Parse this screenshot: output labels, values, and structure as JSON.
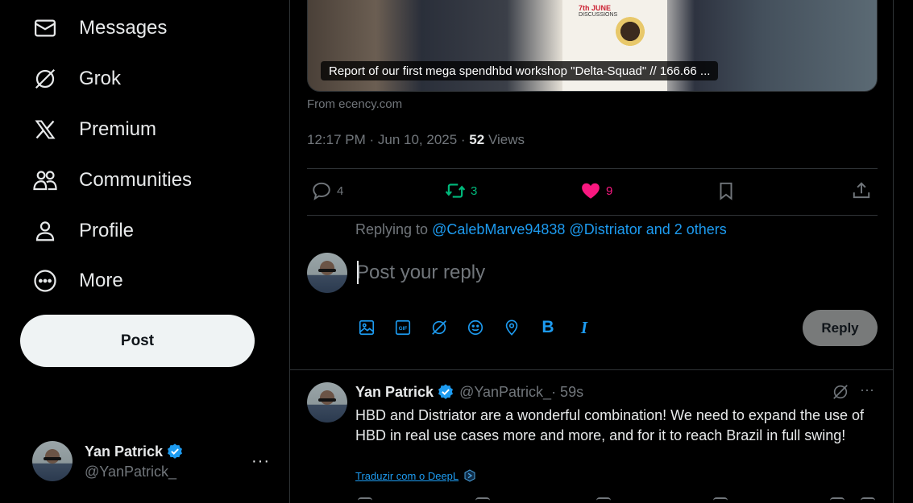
{
  "sidebar": {
    "items": [
      {
        "label": "Messages",
        "icon": "envelope-icon"
      },
      {
        "label": "Grok",
        "icon": "grok-icon"
      },
      {
        "label": "Premium",
        "icon": "x-logo-icon"
      },
      {
        "label": "Communities",
        "icon": "people-icon"
      },
      {
        "label": "Profile",
        "icon": "person-icon"
      },
      {
        "label": "More",
        "icon": "more-circle-icon"
      }
    ],
    "post_label": "Post",
    "account": {
      "name": "Yan Patrick",
      "handle": "@YanPatrick_",
      "more": "···"
    }
  },
  "post": {
    "media_caption": "Report of our first mega spendhbd workshop \"Delta-Squad\" // 166.66 ...",
    "poster_title": "7th JUNE",
    "poster_subtitle": "DISCUSSIONS",
    "source": "From ecency.com",
    "time": "12:17 PM · Jun 10, 2025 · ",
    "views_count": "52",
    "views_label": " Views",
    "stats": {
      "replies": "4",
      "reposts": "3",
      "likes": "9"
    }
  },
  "reply_box": {
    "replying_prefix": "Replying to ",
    "replying_to": "@CalebMarve94838 @Distriator and 2 others",
    "placeholder": "Post your reply",
    "reply_label": "Reply",
    "bold_label": "B",
    "italic_label": "I"
  },
  "reply_tweet": {
    "name": "Yan Patrick",
    "handle": "@YanPatrick_",
    "time": " · 59s",
    "text": "HBD and Distriator are a wonderful combination! We need to expand the use of HBD in real use cases more and more, and for it to reach Brazil in full swing!",
    "translate": "Traduzir com o DeepL",
    "more": "···"
  },
  "colors": {
    "accent": "#1d9bf0",
    "repost": "#00ba7c",
    "like": "#f91880",
    "muted": "#71767b"
  }
}
